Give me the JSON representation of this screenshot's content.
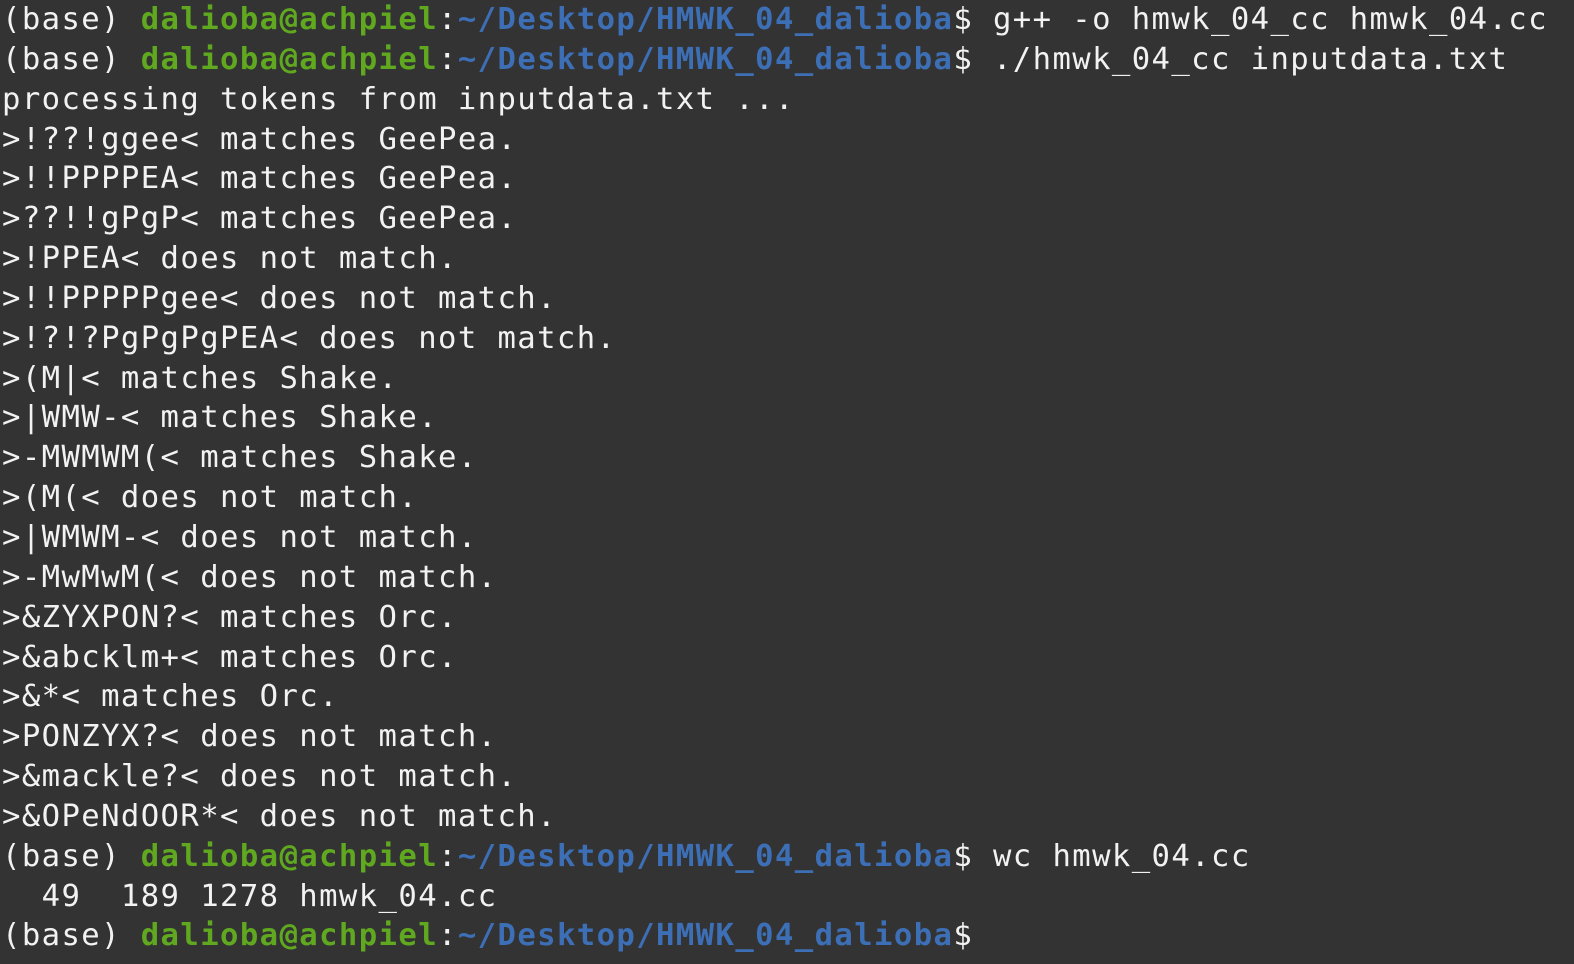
{
  "prompt": {
    "env": "(base) ",
    "user_host": "dalioba@achpiel",
    "sep": ":",
    "path": "~/Desktop/HMWK_04_dalioba",
    "symbol": "$"
  },
  "commands": {
    "compile": " g++ -o hmwk_04_cc hmwk_04.cc",
    "run": " ./hmwk_04_cc inputdata.txt",
    "wc": " wc hmwk_04.cc",
    "final": ""
  },
  "output": [
    "processing tokens from inputdata.txt ...",
    ">!??!ggee< matches GeePea.",
    ">!!PPPPEA< matches GeePea.",
    ">??!!gPgP< matches GeePea.",
    ">!PPEA< does not match.",
    ">!!PPPPPgee< does not match.",
    ">!?!?PgPgPgPEA< does not match.",
    ">(M|< matches Shake.",
    ">|WMW-< matches Shake.",
    ">-MWMWM(< matches Shake.",
    ">(M(< does not match.",
    ">|WMWM-< does not match.",
    ">-MwMwM(< does not match.",
    ">&ZYXPON?< matches Orc.",
    ">&abcklm+< matches Orc.",
    ">&*< matches Orc.",
    ">PONZYX?< does not match.",
    ">&mackle?< does not match.",
    ">&OPeNdOOR*< does not match."
  ],
  "wc_output": "  49  189 1278 hmwk_04.cc",
  "colors": {
    "background": "#333333",
    "text": "#f2f2f2",
    "user_host": "#5fa81f",
    "path": "#3d6fb6"
  }
}
